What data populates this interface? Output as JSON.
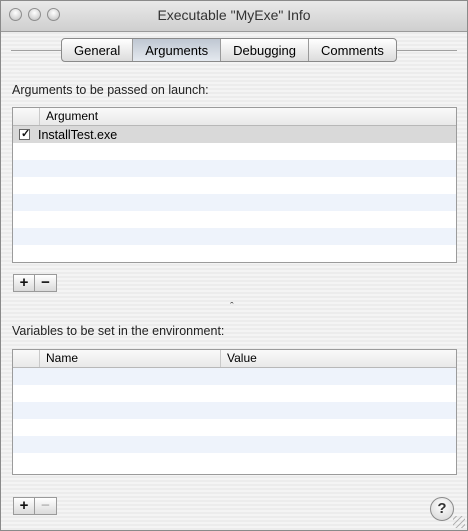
{
  "window": {
    "title": "Executable \"MyExe\" Info"
  },
  "tabs": [
    {
      "label": "General",
      "active": false
    },
    {
      "label": "Arguments",
      "active": true
    },
    {
      "label": "Debugging",
      "active": false
    },
    {
      "label": "Comments",
      "active": false
    }
  ],
  "arguments": {
    "section_label": "Arguments to be passed on launch:",
    "column_header": "Argument",
    "rows": [
      {
        "checked": true,
        "value": "InstallTest.exe"
      }
    ],
    "add_label": "+",
    "remove_label": "−"
  },
  "splitter": {
    "glyph": "ˆ"
  },
  "environment": {
    "section_label": "Variables to be set in the environment:",
    "headers": [
      "Name",
      "Value"
    ],
    "rows": [],
    "add_label": "+",
    "remove_label": "−"
  },
  "help": {
    "label": "?"
  },
  "colors": {
    "table_stripe": "#eef3fb",
    "selected_row": "#d9d9d9",
    "active_tab": "#c9d0da"
  }
}
